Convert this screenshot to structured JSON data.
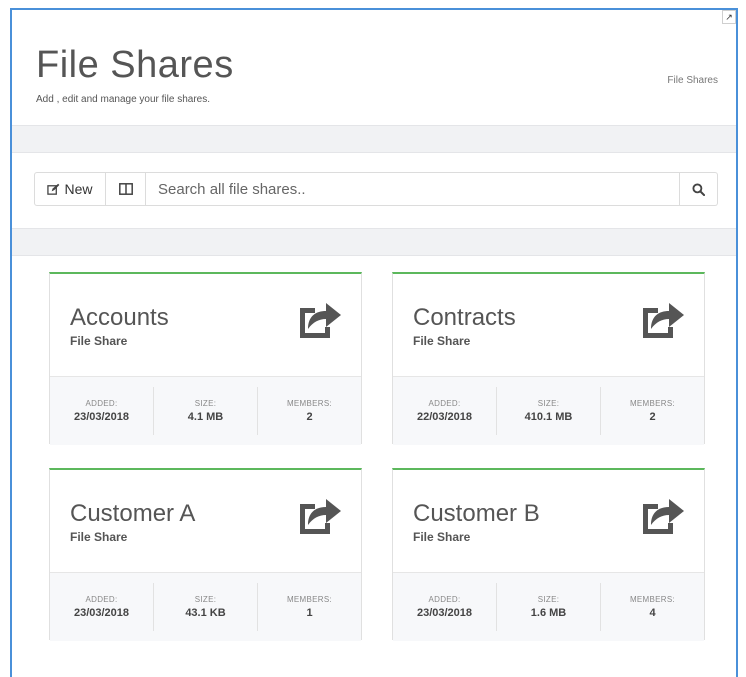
{
  "header": {
    "title": "File Shares",
    "subtitle": "Add , edit and manage your file shares.",
    "breadcrumb": "File Shares"
  },
  "toolbar": {
    "new_label": "New",
    "search_placeholder": "Search all file shares.."
  },
  "stat_labels": {
    "added": "ADDED:",
    "size": "SIZE:",
    "members": "MEMBERS:"
  },
  "shares": [
    {
      "name": "Accounts",
      "type": "File Share",
      "added": "23/03/2018",
      "size": "4.1 MB",
      "members": "2"
    },
    {
      "name": "Contracts",
      "type": "File Share",
      "added": "22/03/2018",
      "size": "410.1 MB",
      "members": "2"
    },
    {
      "name": "Customer A",
      "type": "File Share",
      "added": "23/03/2018",
      "size": "43.1 KB",
      "members": "1"
    },
    {
      "name": "Customer B",
      "type": "File Share",
      "added": "23/03/2018",
      "size": "1.6 MB",
      "members": "4"
    }
  ],
  "colors": {
    "card_accent": "#5cb85c",
    "frame_border": "#4a90d9",
    "band": "#f1f2f4"
  }
}
